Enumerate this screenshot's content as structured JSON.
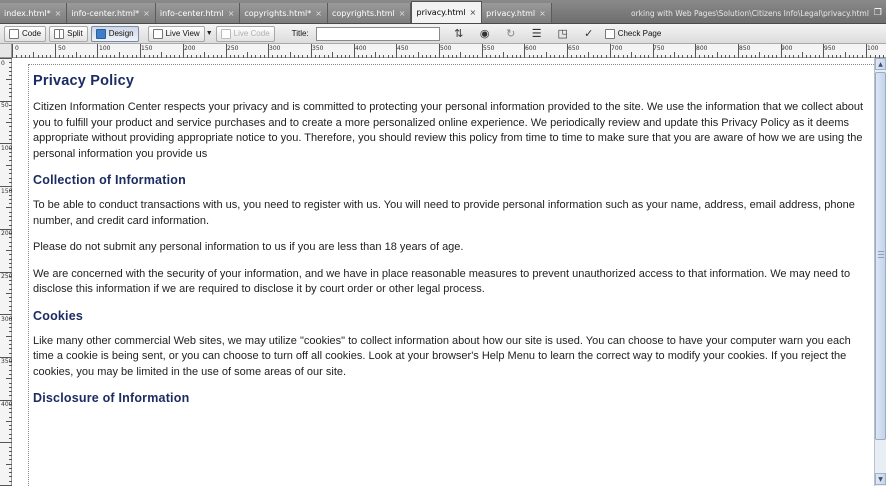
{
  "tabs": [
    {
      "label": "index.html*",
      "close": "×"
    },
    {
      "label": "info-center.html*",
      "close": "×"
    },
    {
      "label": "info-center.html",
      "close": "×"
    },
    {
      "label": "copyrights.html*",
      "close": "×"
    },
    {
      "label": "copyrights.html",
      "close": "×"
    },
    {
      "label": "privacy.html",
      "close": "×"
    },
    {
      "label": "privacy.html",
      "close": "×"
    }
  ],
  "file_path": "orking with Web Pages\\Solution\\Citizens Info\\Legal\\privacy.html",
  "toolbar": {
    "code_label": "Code",
    "split_label": "Split",
    "design_label": "Design",
    "live_view_label": "Live View",
    "live_code_label": "Live Code",
    "title_label": "Title:",
    "title_value": "",
    "check_page_label": "Check Page"
  },
  "ruler": {
    "h_labels": [
      "0",
      "50",
      "100",
      "150",
      "200",
      "250",
      "300",
      "350",
      "400",
      "450",
      "500",
      "550",
      "600",
      "650",
      "700",
      "750",
      "800",
      "850",
      "900",
      "950",
      "100"
    ],
    "v_labels": [
      "0",
      "50",
      "100",
      "150",
      "200",
      "250",
      "300",
      "350",
      "400"
    ]
  },
  "document": {
    "title": "Privacy Policy",
    "intro": "Citizen Information Center respects your privacy and is committed to protecting your personal information provided to the site. We use the information that we collect about you to fulfill your product and service purchases and to create a more personalized online experience. We periodically review and update this Privacy Policy as it deems appropriate without providing appropriate notice to you. Therefore, you should review this policy from time to time to make sure that you are aware of how we are using the personal information you provide us",
    "section1_heading": "Collection of Information",
    "section1_p1": "To be able to conduct transactions with us, you need to register with us. You will need to provide personal information such as your name, address, email address, phone number, and credit card information.",
    "section1_p2": "Please do not submit any personal information to us if you are less than 18 years of age.",
    "section1_p3": "We are concerned with the security of your information, and we have in place reasonable measures to prevent unauthorized access to that information. We may need to disclose this information if we are required to disclose it by court order or other legal process.",
    "section2_heading": "Cookies",
    "section2_p1": "Like many other commercial Web sites, we may utilize \"cookies\" to collect information about how our site is used. You can choose to have your computer warn you each time a cookie is being sent, or you can choose to turn off all cookies. Look at your browser's Help Menu to learn the correct way to modify your cookies. If you reject the cookies, you may be limited in the use of some areas of our site.",
    "section3_heading": "Disclosure of Information"
  },
  "icons": {
    "window_icon": "window-icon",
    "scroll_up": "▲",
    "scroll_down": "▼"
  }
}
